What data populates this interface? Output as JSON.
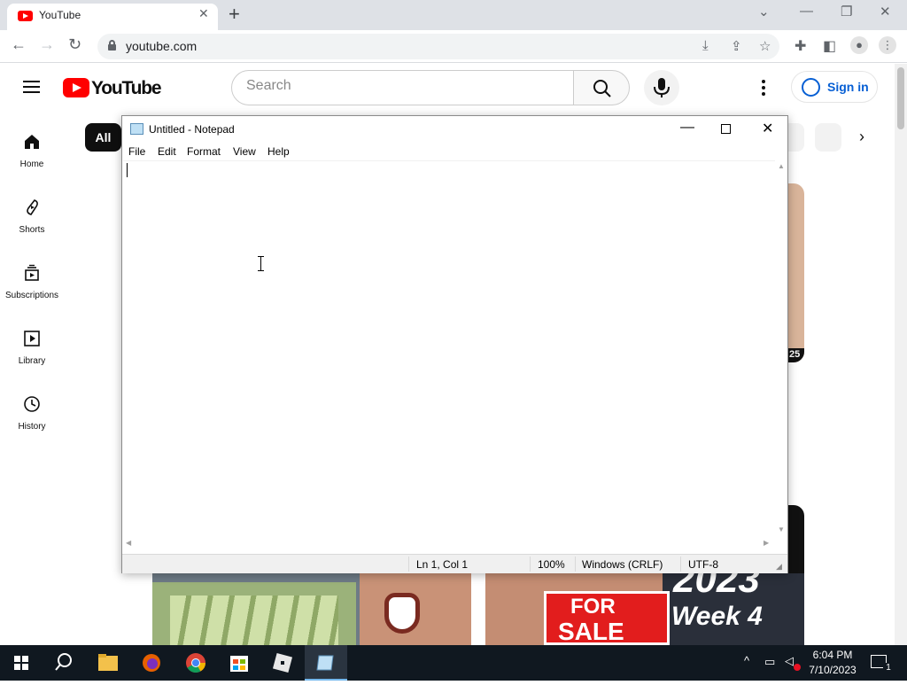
{
  "browser": {
    "tab_title": "YouTube",
    "tab_close": "✕",
    "new_tab": "+",
    "url": "youtube.com"
  },
  "youtube": {
    "logo_text": "YouTube",
    "search_placeholder": "Search",
    "sign_in": "Sign in",
    "sidebar": [
      {
        "label": "Home"
      },
      {
        "label": "Shorts"
      },
      {
        "label": "Subscriptions"
      },
      {
        "label": "Library"
      },
      {
        "label": "History"
      }
    ],
    "chip_all": "All",
    "thumb_sale_line1": "FOR",
    "thumb_sale_line2": "SALE",
    "thumb_year": "2023",
    "thumb_week": "Week 4",
    "thumb_duration_partial": "25"
  },
  "notepad": {
    "title": "Untitled - Notepad",
    "menu": [
      "File",
      "Edit",
      "Format",
      "View",
      "Help"
    ],
    "content": "",
    "status": {
      "position": "Ln 1, Col 1",
      "zoom": "100%",
      "line_ending": "Windows (CRLF)",
      "encoding": "UTF-8"
    }
  },
  "taskbar": {
    "time": "6:04 PM",
    "date": "7/10/2023",
    "notification_count": "1"
  },
  "colors": {
    "youtube_red": "#ff0000",
    "link_blue": "#065fd4",
    "taskbar_bg": "#101820"
  }
}
